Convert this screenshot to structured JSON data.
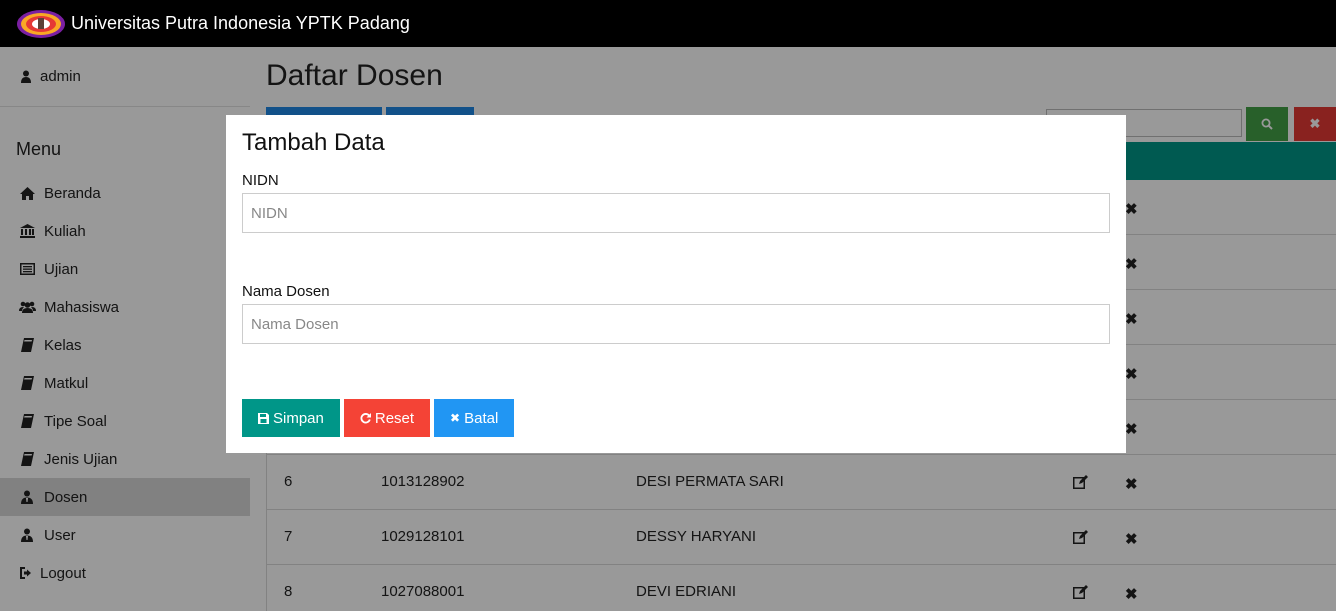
{
  "navbar": {
    "brand": "Universitas Putra Indonesia YPTK Padang"
  },
  "sidebar": {
    "user": "admin",
    "menu_title": "Menu",
    "items": [
      {
        "label": "Beranda",
        "icon": "home-icon"
      },
      {
        "label": "Kuliah",
        "icon": "bank-icon"
      },
      {
        "label": "Ujian",
        "icon": "list-icon"
      },
      {
        "label": "Mahasiswa",
        "icon": "users-icon"
      },
      {
        "label": "Kelas",
        "icon": "book-icon"
      },
      {
        "label": "Matkul",
        "icon": "book-icon"
      },
      {
        "label": "Tipe Soal",
        "icon": "book-icon"
      },
      {
        "label": "Jenis Ujian",
        "icon": "book-icon"
      },
      {
        "label": "Dosen",
        "icon": "user-tie-icon",
        "active": true
      },
      {
        "label": "User",
        "icon": "user-tie-icon"
      },
      {
        "label": "Logout",
        "icon": "sign-out-icon"
      }
    ]
  },
  "main": {
    "title": "Daftar Dosen",
    "rows": [
      {
        "no": "6",
        "nidn": "1013128902",
        "nama": "DESI PERMATA SARI"
      },
      {
        "no": "7",
        "nidn": "1029128101",
        "nama": "DESSY HARYANI"
      },
      {
        "no": "8",
        "nidn": "1027088001",
        "nama": "DEVI EDRIANI"
      }
    ]
  },
  "modal": {
    "title": "Tambah Data",
    "nidn_label": "NIDN",
    "nidn_placeholder": "NIDN",
    "nama_label": "Nama Dosen",
    "nama_placeholder": "Nama Dosen",
    "save_label": "Simpan",
    "reset_label": "Reset",
    "cancel_label": "Batal"
  },
  "colors": {
    "navbar": "#000000",
    "table_header": "#009688",
    "save": "#009688",
    "reset": "#f44336",
    "cancel": "#2196f3",
    "search": "#43a047",
    "clear": "#e53935"
  }
}
